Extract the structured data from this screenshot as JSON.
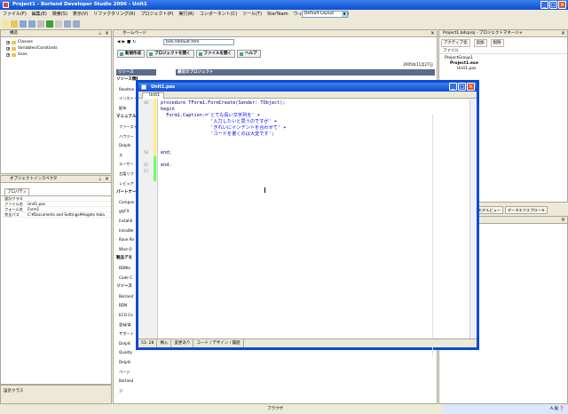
{
  "window": {
    "title": "Project1 - Borland Developer Studio 2006 - Unit1"
  },
  "menu": [
    "ファイル(F)",
    "編集(E)",
    "検索(S)",
    "表示(V)",
    "リファクタリング(R)",
    "プロジェクト(P)",
    "実行(R)",
    "コンポーネント(C)",
    "ツール(T)",
    "StarTeam",
    "ウィンドウ(W)",
    "ヘルプ(H)"
  ],
  "layout_select": "Default Layout",
  "structure": {
    "title": "構造",
    "items": [
      "Classes",
      "Variables/Constants",
      "Uses"
    ]
  },
  "inspector": {
    "title": "オブジェクトインスペクタ",
    "tab": "プロパティ",
    "rows": [
      {
        "k": "設計クラス",
        "v": ""
      },
      {
        "k": "ファイル名",
        "v": "Unit1.pas"
      },
      {
        "k": "フォーム名",
        "v": "Form1"
      },
      {
        "k": "完全パス",
        "v": "C:¥Documents and Settings¥Hagets Hala"
      }
    ],
    "status": "設計クラス"
  },
  "welcome": {
    "tab": "ホームページ",
    "address": "bds:/default.htm",
    "buttons": [
      "新規作成",
      "プロジェクトを開く",
      "ファイルを開く",
      "ヘルプ"
    ],
    "date": "2005年11月27日",
    "sections": [
      "リソース",
      "最近のプロジェクト"
    ],
    "left_items": [
      {
        "t": "リソース情報",
        "h": true
      },
      {
        "t": "Readme",
        "h": false
      },
      {
        "t": "インストール",
        "h": false
      },
      {
        "t": "配布",
        "h": false
      },
      {
        "t": "マニュアル",
        "h": true
      },
      {
        "t": "ファースト",
        "h": false
      },
      {
        "t": "ハウツー",
        "h": false
      },
      {
        "t": "Delphi",
        "h": false
      },
      {
        "t": "ス",
        "h": false
      },
      {
        "t": "ユーザー",
        "h": false
      },
      {
        "t": "言語リフ",
        "h": false
      },
      {
        "t": "レビュア",
        "h": false
      },
      {
        "t": "パートナー",
        "h": true
      },
      {
        "t": "Compon",
        "h": false
      },
      {
        "t": "glyFX",
        "h": false
      },
      {
        "t": "InstallS",
        "h": false
      },
      {
        "t": "IntraWe",
        "h": false
      },
      {
        "t": "Rave Re",
        "h": false
      },
      {
        "t": "Wise O",
        "h": false
      },
      {
        "t": "製品デモ",
        "h": true
      },
      {
        "t": "BDNtv",
        "h": false
      },
      {
        "t": "Code C",
        "h": false
      },
      {
        "t": "リソース",
        "h": true
      },
      {
        "t": "Borland",
        "h": false
      },
      {
        "t": "BDN",
        "h": false
      },
      {
        "t": "ECO Ce",
        "h": false
      },
      {
        "t": "登録/本",
        "h": false
      },
      {
        "t": "サポート",
        "h": false
      },
      {
        "t": "Delphi",
        "h": false
      },
      {
        "t": "Quality",
        "h": false
      },
      {
        "t": "Delphi",
        "h": false
      },
      {
        "t": "ページ",
        "h": false
      },
      {
        "t": "Borland",
        "h": false
      },
      {
        "t": "ジ",
        "h": false
      }
    ]
  },
  "projmgr": {
    "title": "Project1.bdsproj - プロジェクトマネージャ",
    "tools": [
      "アクティブ化",
      "追加",
      "削除"
    ],
    "file_label": "ファイル",
    "nodes": [
      "ProjectGroup1",
      "Project1.exe",
      "Unit1.pas"
    ],
    "tabs": [
      "Project1.bdsproj",
      "モデルビュー",
      "データエクスプローラ"
    ]
  },
  "editor": {
    "title": "Unit1.pas",
    "tab": "Unit1",
    "line_numbers": [
      "40",
      "",
      "",
      "",
      "",
      "",
      "",
      "",
      "50",
      "",
      "52",
      "53"
    ],
    "lines": [
      {
        "parts": [
          {
            "t": "procedure",
            "c": "kw"
          },
          {
            "t": " TForm1.FormCreate(Sender: TObject);",
            "c": "kw"
          }
        ]
      },
      {
        "parts": [
          {
            "t": "begin",
            "c": "kw"
          }
        ]
      },
      {
        "parts": [
          {
            "t": "  Form1.Caption:=",
            "c": "kw"
          },
          {
            "t": "'とても長い文字列を'",
            "c": "str"
          },
          {
            "t": " +",
            "c": "kw"
          }
        ]
      },
      {
        "parts": [
          {
            "t": "                  ",
            "c": ""
          },
          {
            "t": "'入力したいと思うのですが'",
            "c": "str"
          },
          {
            "t": " +",
            "c": "kw"
          }
        ]
      },
      {
        "parts": [
          {
            "t": "                  ",
            "c": ""
          },
          {
            "t": "'きれいにインデントを合わせて'",
            "c": "str"
          },
          {
            "t": " +",
            "c": "kw"
          }
        ]
      },
      {
        "parts": [
          {
            "t": "                  ",
            "c": ""
          },
          {
            "t": "'コードを書くのは大変です'",
            "c": "str"
          },
          {
            "t": ";",
            "c": "kw"
          }
        ]
      },
      {
        "parts": []
      },
      {
        "parts": []
      },
      {
        "parts": [
          {
            "t": "end;",
            "c": "kw"
          }
        ]
      },
      {
        "parts": []
      },
      {
        "parts": [
          {
            "t": "end.",
            "c": "kw"
          }
        ]
      },
      {
        "parts": []
      }
    ],
    "status": [
      "51: 28",
      "挿入",
      "変更あり",
      "コード / デザイン / 履歴"
    ]
  },
  "bottom": {
    "browser_tab": "ブラウザ"
  }
}
